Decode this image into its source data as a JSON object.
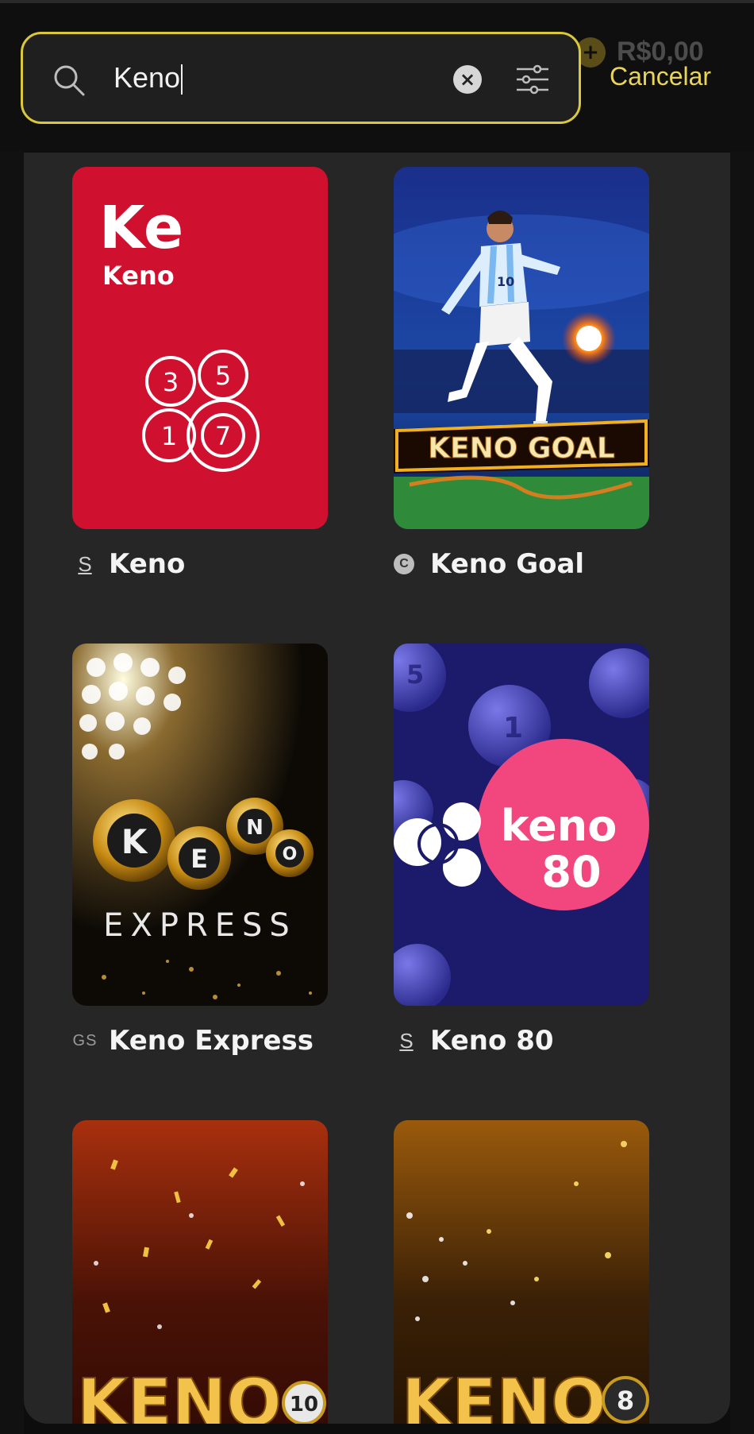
{
  "header": {
    "balance": "R$0,00",
    "search": {
      "value": "Keno"
    },
    "cancel_label": "Cancelar"
  },
  "results": [
    {
      "name": "Keno",
      "provider_badge": "S",
      "art": {
        "title": "Ke",
        "subtitle": "Keno",
        "balls": [
          "3",
          "5",
          "1",
          "7"
        ]
      }
    },
    {
      "name": "Keno Goal",
      "provider_badge": "C",
      "art": {
        "banner": "KENO GOAL",
        "jersey": "10"
      }
    },
    {
      "name": "Keno Express",
      "provider_badge": "GS",
      "art": {
        "balls": [
          "K",
          "E",
          "N",
          "O"
        ],
        "word": "EXPRESS"
      }
    },
    {
      "name": "Keno 80",
      "provider_badge": "S",
      "art": {
        "line1": "keno",
        "line2": "80",
        "balls": [
          "5",
          "1"
        ]
      }
    },
    {
      "name": "",
      "provider_badge": "",
      "art": {
        "word": "KENO",
        "badge": "10"
      }
    },
    {
      "name": "",
      "provider_badge": "",
      "art": {
        "word": "KENO",
        "badge": "8"
      }
    }
  ],
  "colors": {
    "accent": "#d9c83a",
    "cancel": "#e8d55a",
    "panel": "#262626",
    "background": "#0d0d0d"
  },
  "icons": [
    "search-icon",
    "clear-icon",
    "filter-icon",
    "plus-icon"
  ]
}
